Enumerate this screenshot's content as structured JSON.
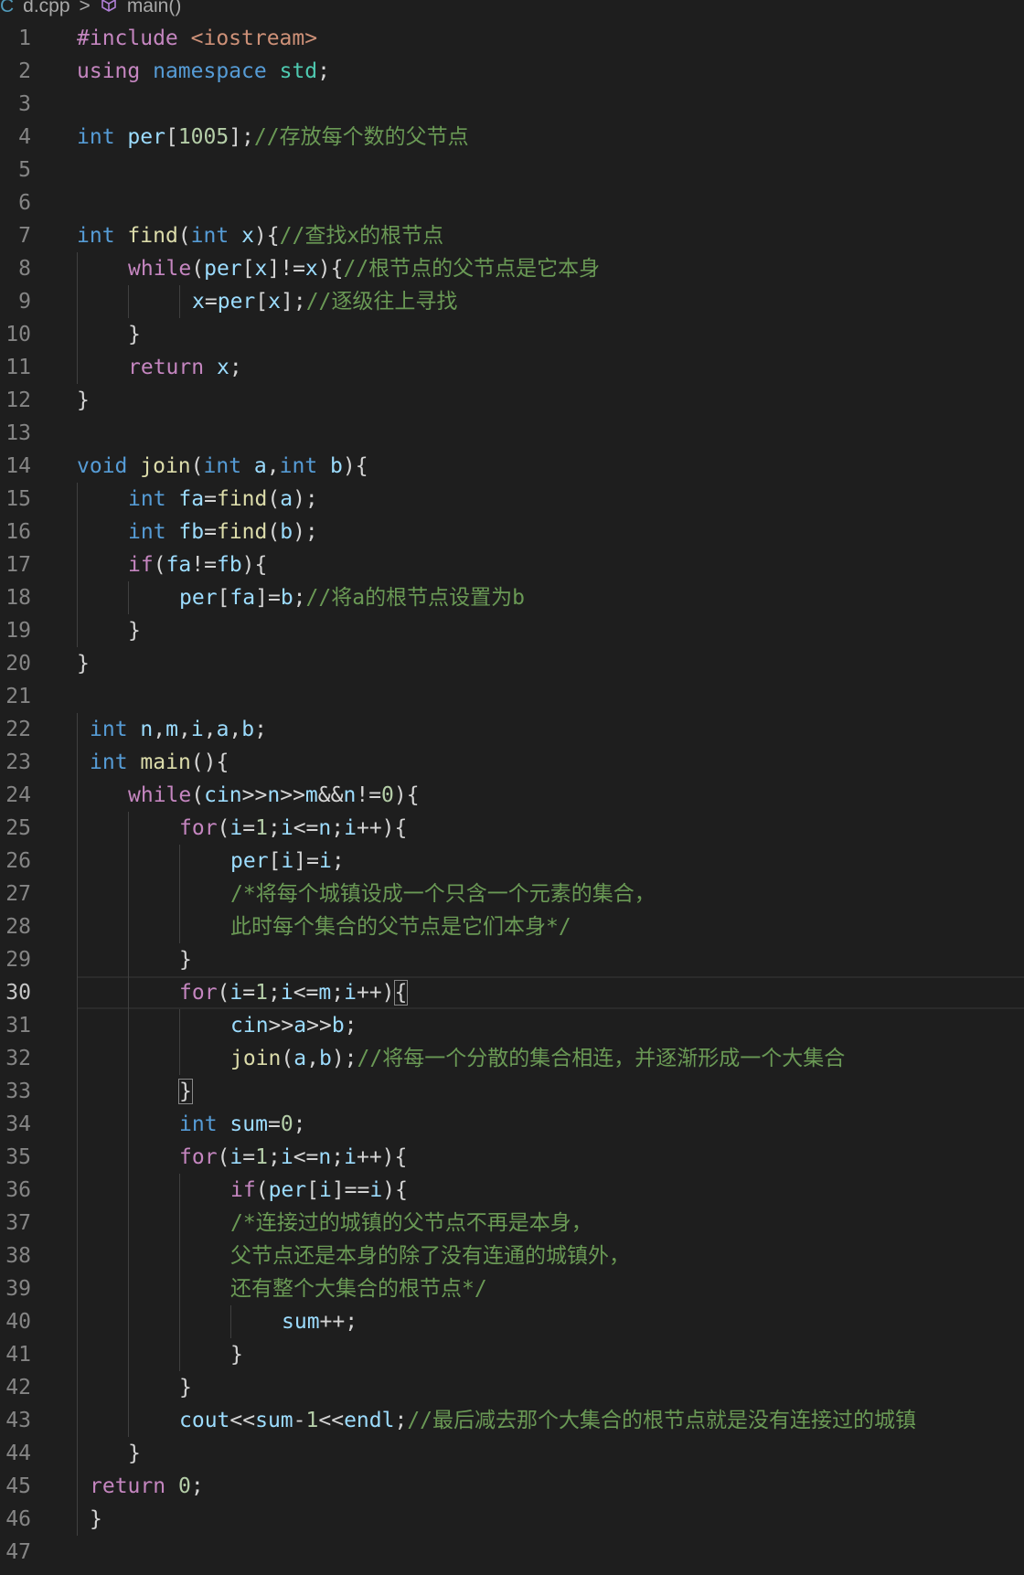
{
  "breadcrumb": {
    "file": "d.cpp",
    "separator": ">",
    "symbol": "main()",
    "file_icon": "cpp-file-icon",
    "symbol_icon": "method-cube-icon"
  },
  "colors": {
    "background": "#1e1e1e",
    "keyword": "#569cd6",
    "control": "#c586c0",
    "function": "#dcdcaa",
    "variable": "#9cdcfe",
    "number": "#b5cea8",
    "string": "#ce9178",
    "comment": "#6a9955",
    "text": "#d4d4d4",
    "line_number": "#858585"
  },
  "active_line": 30,
  "lines": [
    {
      "n": 1,
      "i": 0,
      "g": [],
      "t": [
        [
          "#include ",
          "c"
        ],
        [
          "<iostream>",
          "s"
        ]
      ]
    },
    {
      "n": 2,
      "i": 0,
      "g": [],
      "t": [
        [
          "using",
          "c"
        ],
        [
          " ",
          "p"
        ],
        [
          "namespace",
          "k"
        ],
        [
          " ",
          "p"
        ],
        [
          "std",
          "t"
        ],
        [
          ";",
          "p"
        ]
      ]
    },
    {
      "n": 3,
      "i": 0,
      "g": [],
      "t": []
    },
    {
      "n": 4,
      "i": 0,
      "g": [],
      "t": [
        [
          "int",
          "k"
        ],
        [
          " ",
          "p"
        ],
        [
          "per",
          "v"
        ],
        [
          "[",
          "p"
        ],
        [
          "1005",
          "n"
        ],
        [
          "];",
          "p"
        ],
        [
          "//存放每个数的父节点",
          "m"
        ]
      ]
    },
    {
      "n": 5,
      "i": 0,
      "g": [],
      "t": []
    },
    {
      "n": 6,
      "i": 0,
      "g": [],
      "t": []
    },
    {
      "n": 7,
      "i": 0,
      "g": [],
      "t": [
        [
          "int",
          "k"
        ],
        [
          " ",
          "p"
        ],
        [
          "find",
          "f"
        ],
        [
          "(",
          "p"
        ],
        [
          "int",
          "k"
        ],
        [
          " ",
          "p"
        ],
        [
          "x",
          "v"
        ],
        [
          "){",
          "p"
        ],
        [
          "//查找x的根节点",
          "m"
        ]
      ]
    },
    {
      "n": 8,
      "i": 4,
      "g": [
        0
      ],
      "t": [
        [
          "while",
          "c"
        ],
        [
          "(",
          "p"
        ],
        [
          "per",
          "v"
        ],
        [
          "[",
          "p"
        ],
        [
          "x",
          "v"
        ],
        [
          "]!=",
          "p"
        ],
        [
          "x",
          "v"
        ],
        [
          "){",
          "p"
        ],
        [
          "//根节点的父节点是它本身",
          "m"
        ]
      ]
    },
    {
      "n": 9,
      "i": 9,
      "g": [
        0,
        4,
        8
      ],
      "t": [
        [
          "x",
          "v"
        ],
        [
          "=",
          "p"
        ],
        [
          "per",
          "v"
        ],
        [
          "[",
          "p"
        ],
        [
          "x",
          "v"
        ],
        [
          "];",
          "p"
        ],
        [
          "//逐级往上寻找",
          "m"
        ]
      ]
    },
    {
      "n": 10,
      "i": 4,
      "g": [
        0
      ],
      "t": [
        [
          "}",
          "p"
        ]
      ]
    },
    {
      "n": 11,
      "i": 4,
      "g": [
        0
      ],
      "t": [
        [
          "return",
          "c"
        ],
        [
          " ",
          "p"
        ],
        [
          "x",
          "v"
        ],
        [
          ";",
          "p"
        ]
      ]
    },
    {
      "n": 12,
      "i": 0,
      "g": [],
      "t": [
        [
          "}",
          "p"
        ]
      ]
    },
    {
      "n": 13,
      "i": 0,
      "g": [],
      "t": []
    },
    {
      "n": 14,
      "i": 0,
      "g": [],
      "t": [
        [
          "void",
          "k"
        ],
        [
          " ",
          "p"
        ],
        [
          "join",
          "f"
        ],
        [
          "(",
          "p"
        ],
        [
          "int",
          "k"
        ],
        [
          " ",
          "p"
        ],
        [
          "a",
          "v"
        ],
        [
          ",",
          "p"
        ],
        [
          "int",
          "k"
        ],
        [
          " ",
          "p"
        ],
        [
          "b",
          "v"
        ],
        [
          "){",
          "p"
        ]
      ]
    },
    {
      "n": 15,
      "i": 4,
      "g": [
        0
      ],
      "t": [
        [
          "int",
          "k"
        ],
        [
          " ",
          "p"
        ],
        [
          "fa",
          "v"
        ],
        [
          "=",
          "p"
        ],
        [
          "find",
          "f"
        ],
        [
          "(",
          "p"
        ],
        [
          "a",
          "v"
        ],
        [
          ");",
          "p"
        ]
      ]
    },
    {
      "n": 16,
      "i": 4,
      "g": [
        0
      ],
      "t": [
        [
          "int",
          "k"
        ],
        [
          " ",
          "p"
        ],
        [
          "fb",
          "v"
        ],
        [
          "=",
          "p"
        ],
        [
          "find",
          "f"
        ],
        [
          "(",
          "p"
        ],
        [
          "b",
          "v"
        ],
        [
          ");",
          "p"
        ]
      ]
    },
    {
      "n": 17,
      "i": 4,
      "g": [
        0
      ],
      "t": [
        [
          "if",
          "c"
        ],
        [
          "(",
          "p"
        ],
        [
          "fa",
          "v"
        ],
        [
          "!=",
          "p"
        ],
        [
          "fb",
          "v"
        ],
        [
          "){",
          "p"
        ]
      ]
    },
    {
      "n": 18,
      "i": 8,
      "g": [
        0,
        4
      ],
      "t": [
        [
          "per",
          "v"
        ],
        [
          "[",
          "p"
        ],
        [
          "fa",
          "v"
        ],
        [
          "]=",
          "p"
        ],
        [
          "b",
          "v"
        ],
        [
          ";",
          "p"
        ],
        [
          "//将a的根节点设置为b",
          "m"
        ]
      ]
    },
    {
      "n": 19,
      "i": 4,
      "g": [
        0
      ],
      "t": [
        [
          "}",
          "p"
        ]
      ]
    },
    {
      "n": 20,
      "i": 0,
      "g": [],
      "t": [
        [
          "}",
          "p"
        ]
      ]
    },
    {
      "n": 21,
      "i": 0,
      "g": [],
      "t": []
    },
    {
      "n": 22,
      "i": 1,
      "g": [
        0
      ],
      "t": [
        [
          "int",
          "k"
        ],
        [
          " ",
          "p"
        ],
        [
          "n",
          "v"
        ],
        [
          ",",
          "p"
        ],
        [
          "m",
          "v"
        ],
        [
          ",",
          "p"
        ],
        [
          "i",
          "v"
        ],
        [
          ",",
          "p"
        ],
        [
          "a",
          "v"
        ],
        [
          ",",
          "p"
        ],
        [
          "b",
          "v"
        ],
        [
          ";",
          "p"
        ]
      ]
    },
    {
      "n": 23,
      "i": 1,
      "g": [
        0
      ],
      "t": [
        [
          "int",
          "k"
        ],
        [
          " ",
          "p"
        ],
        [
          "main",
          "f"
        ],
        [
          "(){",
          "p"
        ]
      ]
    },
    {
      "n": 24,
      "i": 4,
      "g": [
        0
      ],
      "t": [
        [
          "while",
          "c"
        ],
        [
          "(",
          "p"
        ],
        [
          "cin",
          "v"
        ],
        [
          ">>",
          "p"
        ],
        [
          "n",
          "v"
        ],
        [
          ">>",
          "p"
        ],
        [
          "m",
          "v"
        ],
        [
          "&&",
          "p"
        ],
        [
          "n",
          "v"
        ],
        [
          "!=",
          "p"
        ],
        [
          "0",
          "n"
        ],
        [
          "){",
          "p"
        ]
      ]
    },
    {
      "n": 25,
      "i": 8,
      "g": [
        0,
        4
      ],
      "t": [
        [
          "for",
          "c"
        ],
        [
          "(",
          "p"
        ],
        [
          "i",
          "v"
        ],
        [
          "=",
          "p"
        ],
        [
          "1",
          "n"
        ],
        [
          ";",
          "p"
        ],
        [
          "i",
          "v"
        ],
        [
          "<=",
          "p"
        ],
        [
          "n",
          "v"
        ],
        [
          ";",
          "p"
        ],
        [
          "i",
          "v"
        ],
        [
          "++){",
          "p"
        ]
      ]
    },
    {
      "n": 26,
      "i": 12,
      "g": [
        0,
        4,
        8
      ],
      "t": [
        [
          "per",
          "v"
        ],
        [
          "[",
          "p"
        ],
        [
          "i",
          "v"
        ],
        [
          "]=",
          "p"
        ],
        [
          "i",
          "v"
        ],
        [
          ";",
          "p"
        ]
      ]
    },
    {
      "n": 27,
      "i": 12,
      "g": [
        0,
        4,
        8
      ],
      "t": [
        [
          "/*将每个城镇设成一个只含一个元素的集合，",
          "m"
        ]
      ]
    },
    {
      "n": 28,
      "i": 12,
      "g": [
        0,
        4,
        8
      ],
      "t": [
        [
          "此时每个集合的父节点是它们本身*/",
          "m"
        ]
      ]
    },
    {
      "n": 29,
      "i": 8,
      "g": [
        0,
        4
      ],
      "t": [
        [
          "}",
          "p"
        ]
      ]
    },
    {
      "n": 30,
      "i": 8,
      "g": [
        0,
        4
      ],
      "t": [
        [
          "for",
          "c"
        ],
        [
          "(",
          "p"
        ],
        [
          "i",
          "v"
        ],
        [
          "=",
          "p"
        ],
        [
          "1",
          "n"
        ],
        [
          ";",
          "p"
        ],
        [
          "i",
          "v"
        ],
        [
          "<=",
          "p"
        ],
        [
          "m",
          "v"
        ],
        [
          ";",
          "p"
        ],
        [
          "i",
          "v"
        ],
        [
          "++)",
          "p"
        ],
        [
          "{",
          "h"
        ]
      ]
    },
    {
      "n": 31,
      "i": 12,
      "g": [
        0,
        4,
        8
      ],
      "t": [
        [
          "cin",
          "v"
        ],
        [
          ">>",
          "p"
        ],
        [
          "a",
          "v"
        ],
        [
          ">>",
          "p"
        ],
        [
          "b",
          "v"
        ],
        [
          ";",
          "p"
        ]
      ]
    },
    {
      "n": 32,
      "i": 12,
      "g": [
        0,
        4,
        8
      ],
      "t": [
        [
          "join",
          "f"
        ],
        [
          "(",
          "p"
        ],
        [
          "a",
          "v"
        ],
        [
          ",",
          "p"
        ],
        [
          "b",
          "v"
        ],
        [
          ");",
          "p"
        ],
        [
          "//将每一个分散的集合相连，并逐渐形成一个大集合",
          "m"
        ]
      ]
    },
    {
      "n": 33,
      "i": 8,
      "g": [
        0,
        4
      ],
      "t": [
        [
          "}",
          "h"
        ]
      ]
    },
    {
      "n": 34,
      "i": 8,
      "g": [
        0,
        4
      ],
      "t": [
        [
          "int",
          "k"
        ],
        [
          " ",
          "p"
        ],
        [
          "sum",
          "v"
        ],
        [
          "=",
          "p"
        ],
        [
          "0",
          "n"
        ],
        [
          ";",
          "p"
        ]
      ]
    },
    {
      "n": 35,
      "i": 8,
      "g": [
        0,
        4
      ],
      "t": [
        [
          "for",
          "c"
        ],
        [
          "(",
          "p"
        ],
        [
          "i",
          "v"
        ],
        [
          "=",
          "p"
        ],
        [
          "1",
          "n"
        ],
        [
          ";",
          "p"
        ],
        [
          "i",
          "v"
        ],
        [
          "<=",
          "p"
        ],
        [
          "n",
          "v"
        ],
        [
          ";",
          "p"
        ],
        [
          "i",
          "v"
        ],
        [
          "++){",
          "p"
        ]
      ]
    },
    {
      "n": 36,
      "i": 12,
      "g": [
        0,
        4,
        8
      ],
      "t": [
        [
          "if",
          "c"
        ],
        [
          "(",
          "p"
        ],
        [
          "per",
          "v"
        ],
        [
          "[",
          "p"
        ],
        [
          "i",
          "v"
        ],
        [
          "]==",
          "p"
        ],
        [
          "i",
          "v"
        ],
        [
          "){",
          "p"
        ]
      ]
    },
    {
      "n": 37,
      "i": 12,
      "g": [
        0,
        4,
        8
      ],
      "t": [
        [
          "/*连接过的城镇的父节点不再是本身，",
          "m"
        ]
      ]
    },
    {
      "n": 38,
      "i": 12,
      "g": [
        0,
        4,
        8
      ],
      "t": [
        [
          "父节点还是本身的除了没有连通的城镇外，",
          "m"
        ]
      ]
    },
    {
      "n": 39,
      "i": 12,
      "g": [
        0,
        4,
        8
      ],
      "t": [
        [
          "还有整个大集合的根节点*/",
          "m"
        ]
      ]
    },
    {
      "n": 40,
      "i": 16,
      "g": [
        0,
        4,
        8,
        12
      ],
      "t": [
        [
          "sum",
          "v"
        ],
        [
          "++;",
          "p"
        ]
      ]
    },
    {
      "n": 41,
      "i": 12,
      "g": [
        0,
        4,
        8
      ],
      "t": [
        [
          "}",
          "p"
        ]
      ]
    },
    {
      "n": 42,
      "i": 8,
      "g": [
        0,
        4
      ],
      "t": [
        [
          "}",
          "p"
        ]
      ]
    },
    {
      "n": 43,
      "i": 8,
      "g": [
        0,
        4
      ],
      "t": [
        [
          "cout",
          "v"
        ],
        [
          "<<",
          "p"
        ],
        [
          "sum",
          "v"
        ],
        [
          "-",
          "p"
        ],
        [
          "1",
          "n"
        ],
        [
          "<<",
          "p"
        ],
        [
          "endl",
          "v"
        ],
        [
          ";",
          "p"
        ],
        [
          "//最后减去那个大集合的根节点就是没有连接过的城镇",
          "m"
        ]
      ]
    },
    {
      "n": 44,
      "i": 4,
      "g": [
        0
      ],
      "t": [
        [
          "}",
          "p"
        ]
      ]
    },
    {
      "n": 45,
      "i": 1,
      "g": [
        0
      ],
      "t": [
        [
          "return",
          "c"
        ],
        [
          " ",
          "p"
        ],
        [
          "0",
          "n"
        ],
        [
          ";",
          "p"
        ]
      ]
    },
    {
      "n": 46,
      "i": 1,
      "g": [
        0
      ],
      "t": [
        [
          "}",
          "p"
        ]
      ]
    },
    {
      "n": 47,
      "i": 0,
      "g": [],
      "t": []
    }
  ]
}
